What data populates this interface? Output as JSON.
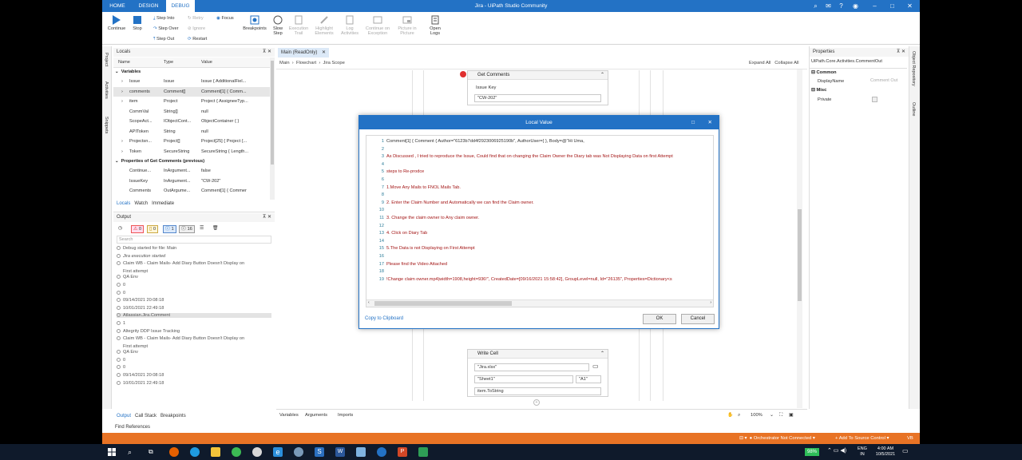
{
  "titlebar": {
    "tabs": [
      "HOME",
      "DESIGN",
      "DEBUG"
    ],
    "title": "Jira - UiPath Studio Community"
  },
  "ribbon": {
    "continue": "Continue",
    "stop": "Stop",
    "step_into": "Step Into",
    "step_over": "Step Over",
    "step_out": "Step Out",
    "retry": "Retry",
    "ignore": "Ignore",
    "restart": "Restart",
    "focus": "Focus",
    "breakpoints": "Breakpoints",
    "slow_step": [
      "Slow",
      "Step"
    ],
    "execution_trail": [
      "Execution",
      "Trail"
    ],
    "highlight_elements": [
      "Highlight",
      "Elements"
    ],
    "log_activities": [
      "Log",
      "Activities"
    ],
    "continue_on_exception": [
      "Continue on",
      "Exception"
    ],
    "picture_in_picture": [
      "Picture in",
      "Picture"
    ],
    "open_logs": [
      "Open",
      "Logs"
    ]
  },
  "left_strip": [
    "Project",
    "Activities",
    "Snippets"
  ],
  "locals": {
    "title": "Locals",
    "columns": [
      "Name",
      "Type",
      "Value"
    ],
    "section_variables": "Variables",
    "variables": [
      {
        "name": "Issue",
        "type": "Issue",
        "value": "Issue { AdditionalFiel..."
      },
      {
        "name": "comments",
        "type": "Comment[]",
        "value": "Comment[1] { Comm..."
      },
      {
        "name": "item",
        "type": "Project",
        "value": "Project { AssigneeTyp..."
      },
      {
        "name": "CommVal",
        "type": "String[]",
        "value": "null"
      },
      {
        "name": "ScopeAct...",
        "type": "IObjectCont...",
        "value": "ObjectContainer { }"
      },
      {
        "name": "APIToken",
        "type": "String",
        "value": "null"
      },
      {
        "name": "Projectsn...",
        "type": "Project[]",
        "value": "Project[25] { Project {..."
      },
      {
        "name": "Token",
        "type": "SecureString",
        "value": "SecureString { Length..."
      }
    ],
    "section_properties": "Properties of Get Comments (previous)",
    "properties": [
      {
        "name": "Continue...",
        "type": "InArgument...",
        "value": "false"
      },
      {
        "name": "IssueKey",
        "type": "InArgument...",
        "value": "\"CW-202\""
      },
      {
        "name": "Comments",
        "type": "OutArgume...",
        "value": "Comment[1] { Commer"
      }
    ],
    "tabs": [
      "Locals",
      "Watch",
      "Immediate"
    ]
  },
  "output": {
    "title": "Output",
    "counts": [
      "0",
      "0",
      "1",
      "16"
    ],
    "search_placeholder": "Search",
    "lines": [
      "Debug started for file: Main",
      "Jira execution started",
      "Claim WB - Claim Mails- Add Diary Button Doesn't Display on",
      "First attempt",
      "QA Env",
      "0",
      "0",
      "09/14/2021 20:08:18",
      "10/01/2021 22:49:18",
      "Atlassian.Jira.Comment",
      "1",
      "Altegrity DDP Issue Tracking",
      "Claim WB - Claim Mails- Add Diary Button Doesn't Display on",
      "First attempt",
      "QA Env",
      "0",
      "0",
      "09/14/2021 20:08:18",
      "10/01/2021 22:49:18"
    ],
    "tabs": [
      "Output",
      "Call Stack",
      "Breakpoints"
    ],
    "find_references": "Find References"
  },
  "designer": {
    "tab": "Main (ReadOnly)",
    "breadcrumb": [
      "Main",
      "Flowchart",
      "Jira Scope"
    ],
    "expand_all": "Expand All",
    "collapse_all": "Collapse All",
    "get_comments": {
      "title": "Get Comments",
      "label": "Issue Key",
      "value": "\"CW-202\""
    },
    "write_cell": {
      "title": "Write Cell",
      "file": "\"Jira.xlsx\"",
      "sheet": "\"Sheet1\"",
      "cell": "\"A1\"",
      "value": "item.ToString"
    },
    "bottom_tabs": [
      "Variables",
      "Arguments",
      "Imports"
    ],
    "zoom": "100%"
  },
  "dialog": {
    "title": "Local Value",
    "lines": [
      "Comment[1] { Comment { Author=\"6123b7dd4f2923006925190b\", AuthorUser={ }, Body=@\"Hi Uma,",
      "",
      "As Discussed , I tried to reproduce the Issue, Could find that on changing the Claim Owner the Diary tab was Not Displaying Data on first Attempt",
      "",
      "steps to Re-prodce",
      "",
      "1.Move Any  Mails to FNOL Mails Tab.",
      "",
      "2. Enter the Claim Number and Automatically we can find the Claim owner.",
      "",
      "3. Change the claim owner to Any claim owner.",
      "",
      "4. Click on Diary Tab",
      "",
      "5.The Data is not Displaying on First Attempt",
      "",
      "Please find the Video Attached",
      "",
      "!Change claim owner.mp4|width=1908,height=936!\", CreatedDate=[09/16/2021 15:58:42], GroupLevel=null, Id=\"26135\", Properties=Dictionary<s"
    ],
    "copy": "Copy to Clipboard",
    "ok": "OK",
    "cancel": "Cancel"
  },
  "properties": {
    "title": "Properties",
    "subtitle": "UiPath.Core.Activities.CommentOut",
    "common": "Common",
    "display_name_label": "DisplayName",
    "display_name_value": "Comment Out",
    "misc": "Misc",
    "private_label": "Private"
  },
  "right_strip": [
    "Object Repository",
    "Outline"
  ],
  "statusbar": {
    "orchestrator": "Orchestrator Not Connected",
    "source_control": "Add To Source Control",
    "vb": "VB"
  },
  "taskbar": {
    "battery": "98%",
    "lang": [
      "ENG",
      "IN"
    ],
    "time": "4:00 AM",
    "date": "10/5/2021"
  },
  "colors": {
    "accent": "#2372c5",
    "status": "#e87325",
    "code": "#a31515"
  }
}
